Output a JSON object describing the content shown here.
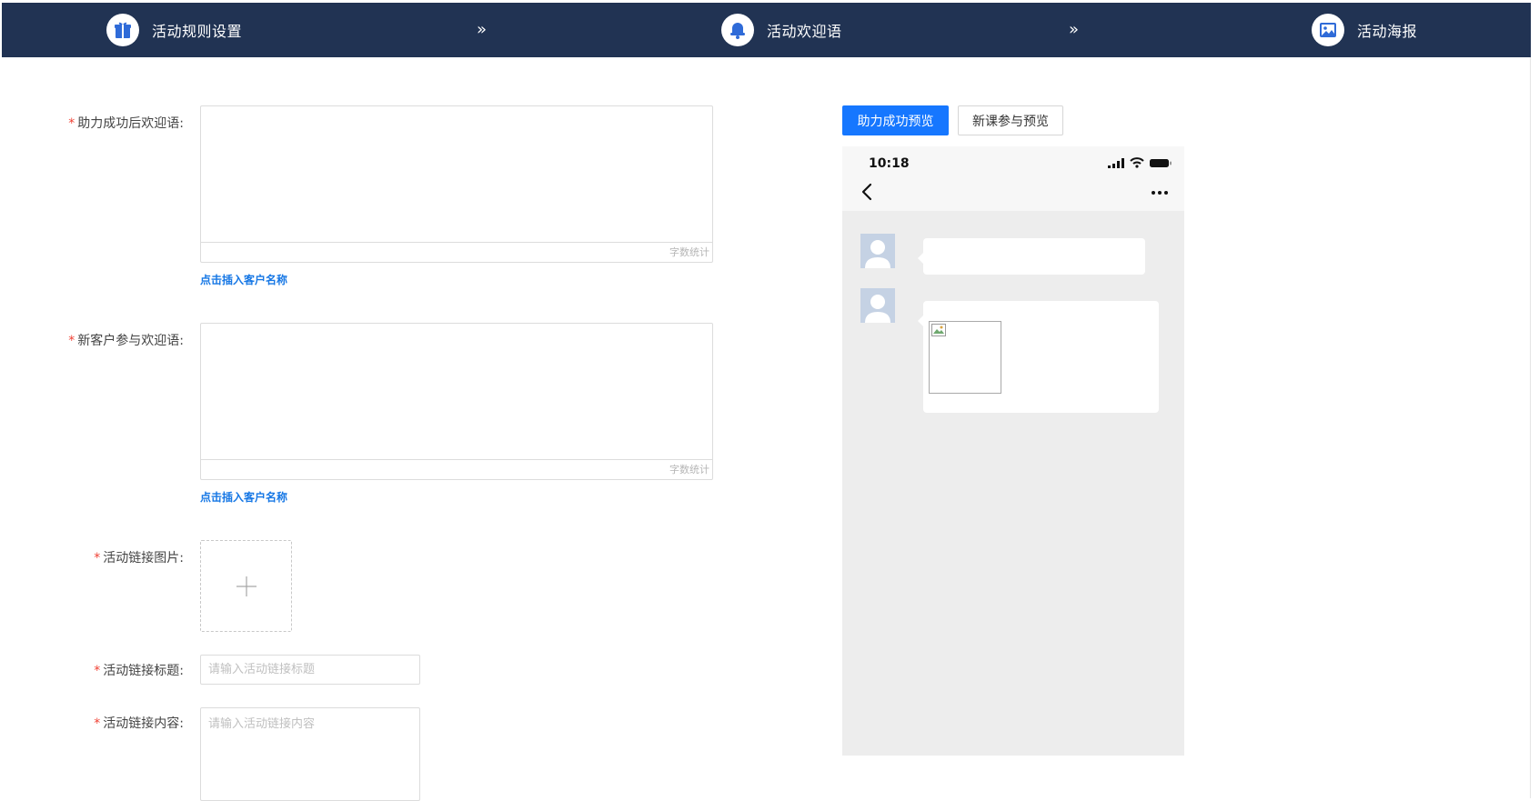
{
  "steps": [
    {
      "label": "活动规则设置",
      "icon": "gift-icon"
    },
    {
      "label": "活动欢迎语",
      "icon": "bell-icon"
    },
    {
      "label": "活动海报",
      "icon": "image-icon"
    }
  ],
  "step_separator": "»",
  "form": {
    "required_mark": "*",
    "success_welcome": {
      "label": "助力成功后欢迎语:",
      "counter": "字数统计",
      "insert_link": "点击插入客户名称"
    },
    "new_customer_welcome": {
      "label": "新客户参与欢迎语:",
      "counter": "字数统计",
      "insert_link": "点击插入客户名称"
    },
    "link_image": {
      "label": "活动链接图片:",
      "upload_icon": "plus-icon"
    },
    "link_title": {
      "label": "活动链接标题:",
      "placeholder": "请输入活动链接标题"
    },
    "link_content": {
      "label": "活动链接内容:",
      "placeholder": "请输入活动链接内容"
    }
  },
  "preview": {
    "tabs": [
      {
        "label": "助力成功预览",
        "active": true
      },
      {
        "label": "新课参与预览",
        "active": false
      }
    ],
    "phone": {
      "time": "10:18"
    }
  },
  "colors": {
    "header_bg": "#213353",
    "primary": "#1677ff",
    "link": "#1677e5",
    "required": "#f04134",
    "phone_bg": "#ededed"
  }
}
